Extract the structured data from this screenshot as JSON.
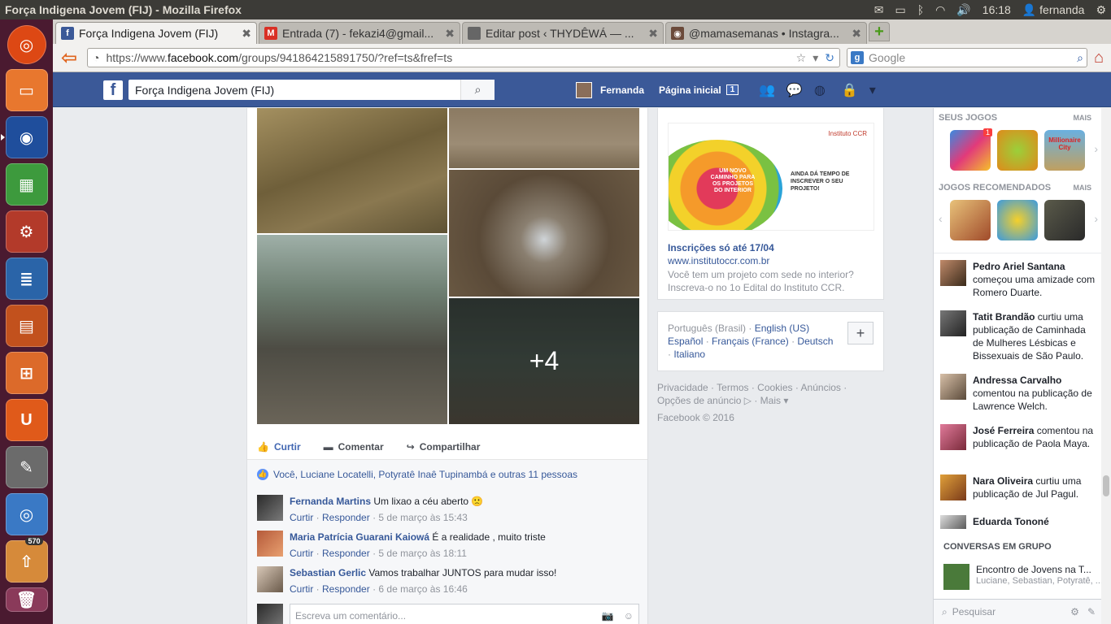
{
  "window": {
    "title": "Força Indigena Jovem (FIJ) - Mozilla Firefox"
  },
  "system": {
    "time": "16:18",
    "user": "fernanda"
  },
  "browser": {
    "tabs": [
      {
        "label": "Força Indigena Jovem (FIJ)",
        "active": true
      },
      {
        "label": "Entrada (7) - fekazi4@gmail...",
        "active": false
      },
      {
        "label": "Editar post ‹ THYDÊWÁ — ...",
        "active": false
      },
      {
        "label": "@mamasemanas • Instagra...",
        "active": false
      }
    ],
    "url_prefix": "https://www.",
    "url_host": "facebook.com",
    "url_path": "/groups/941864215891750/?ref=ts&fref=ts",
    "search_placeholder": "Google"
  },
  "fb": {
    "search_value": "Força Indigena Jovem (FIJ)",
    "user_name": "Fernanda",
    "home_label": "Página inicial",
    "home_count": "1"
  },
  "post": {
    "more_photos": "+4",
    "actions": {
      "like": "Curtir",
      "comment": "Comentar",
      "share": "Compartilhar"
    },
    "likes_text": "Você, Luciane Locatelli, Potyratê Inaê Tupinambá e outras 11 pessoas",
    "comments": [
      {
        "name": "Fernanda Martins",
        "text": "Um lixao a céu aberto 🙁",
        "like": "Curtir",
        "reply": "Responder",
        "time": "5 de março às 15:43"
      },
      {
        "name": "Maria Patrícia Guarani Kaiowá",
        "text": "É a realidade , muito triste",
        "like": "Curtir",
        "reply": "Responder",
        "time": "5 de março às 18:11"
      },
      {
        "name": "Sebastian Gerlic",
        "text": "Vamos trabalhar JUNTOS para mudar isso!",
        "like": "Curtir",
        "reply": "Responder",
        "time": "6 de março às 16:46"
      }
    ],
    "comment_placeholder": "Escreva um comentário..."
  },
  "ad": {
    "image_text_1": "UM NOVO CAMINHO PARA OS PROJETOS DO INTERIOR",
    "image_text_2": "AINDA DÁ TEMPO DE INSCREVER O SEU PROJETO!",
    "image_brand": "Instituto CCR",
    "title": "Inscrições só até 17/04",
    "link": "www.institutoccr.com.br",
    "desc": "Você tem um projeto com sede no interior? Inscreva-o no 1o Edital do Instituto CCR."
  },
  "langs": {
    "current": "Português (Brasil)",
    "options": [
      "English (US)",
      "Español",
      "Français (France)",
      "Deutsch",
      "Italiano"
    ]
  },
  "footer": {
    "links": [
      "Privacidade",
      "Termos",
      "Cookies",
      "Anúncios",
      "Opções de anúncio",
      "Mais"
    ],
    "copyright": "Facebook © 2016"
  },
  "sidebar": {
    "my_games": "SEUS JOGOS",
    "more1": "MAIS",
    "recommended": "JOGOS RECOMENDADOS",
    "more2": "MAIS",
    "game_badge": "1",
    "game_title_3": "Millionaire City",
    "ticker": [
      {
        "name": "Pedro Ariel Santana",
        "text": " começou uma amizade com Romero Duarte."
      },
      {
        "name": "Tatit Brandão",
        "text": " curtiu uma publicação de Caminhada de Mulheres Lésbicas e Bissexuais de São Paulo."
      },
      {
        "name": "Andressa Carvalho",
        "text": " comentou na publicação de Lawrence Welch."
      },
      {
        "name": "José Ferreira",
        "text": " comentou na publicação de Paola Maya."
      },
      {
        "name": "Nara Oliveira",
        "text": " curtiu uma publicação de Jul Pagul."
      },
      {
        "name": "Eduarda Tononé",
        "text": ""
      }
    ],
    "group_chats": "CONVERSAS EM GRUPO",
    "conv_title": "Encontro de Jovens na T...",
    "conv_members": "Luciane, Sebastian, Potyratê, ...",
    "chat_search": "Pesquisar"
  },
  "launcher": {
    "badge": "570"
  }
}
